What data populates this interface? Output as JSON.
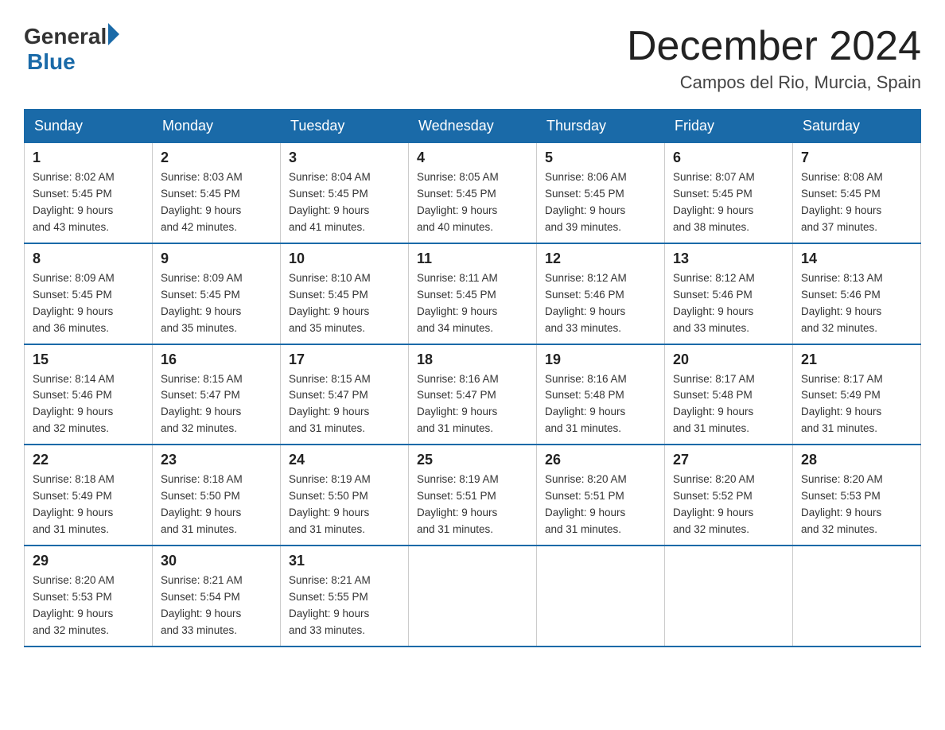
{
  "logo": {
    "text_general": "General",
    "text_blue": "Blue"
  },
  "header": {
    "month_year": "December 2024",
    "location": "Campos del Rio, Murcia, Spain"
  },
  "weekdays": [
    "Sunday",
    "Monday",
    "Tuesday",
    "Wednesday",
    "Thursday",
    "Friday",
    "Saturday"
  ],
  "weeks": [
    [
      {
        "day": "1",
        "sunrise": "8:02 AM",
        "sunset": "5:45 PM",
        "daylight": "9 hours and 43 minutes."
      },
      {
        "day": "2",
        "sunrise": "8:03 AM",
        "sunset": "5:45 PM",
        "daylight": "9 hours and 42 minutes."
      },
      {
        "day": "3",
        "sunrise": "8:04 AM",
        "sunset": "5:45 PM",
        "daylight": "9 hours and 41 minutes."
      },
      {
        "day": "4",
        "sunrise": "8:05 AM",
        "sunset": "5:45 PM",
        "daylight": "9 hours and 40 minutes."
      },
      {
        "day": "5",
        "sunrise": "8:06 AM",
        "sunset": "5:45 PM",
        "daylight": "9 hours and 39 minutes."
      },
      {
        "day": "6",
        "sunrise": "8:07 AM",
        "sunset": "5:45 PM",
        "daylight": "9 hours and 38 minutes."
      },
      {
        "day": "7",
        "sunrise": "8:08 AM",
        "sunset": "5:45 PM",
        "daylight": "9 hours and 37 minutes."
      }
    ],
    [
      {
        "day": "8",
        "sunrise": "8:09 AM",
        "sunset": "5:45 PM",
        "daylight": "9 hours and 36 minutes."
      },
      {
        "day": "9",
        "sunrise": "8:09 AM",
        "sunset": "5:45 PM",
        "daylight": "9 hours and 35 minutes."
      },
      {
        "day": "10",
        "sunrise": "8:10 AM",
        "sunset": "5:45 PM",
        "daylight": "9 hours and 35 minutes."
      },
      {
        "day": "11",
        "sunrise": "8:11 AM",
        "sunset": "5:45 PM",
        "daylight": "9 hours and 34 minutes."
      },
      {
        "day": "12",
        "sunrise": "8:12 AM",
        "sunset": "5:46 PM",
        "daylight": "9 hours and 33 minutes."
      },
      {
        "day": "13",
        "sunrise": "8:12 AM",
        "sunset": "5:46 PM",
        "daylight": "9 hours and 33 minutes."
      },
      {
        "day": "14",
        "sunrise": "8:13 AM",
        "sunset": "5:46 PM",
        "daylight": "9 hours and 32 minutes."
      }
    ],
    [
      {
        "day": "15",
        "sunrise": "8:14 AM",
        "sunset": "5:46 PM",
        "daylight": "9 hours and 32 minutes."
      },
      {
        "day": "16",
        "sunrise": "8:15 AM",
        "sunset": "5:47 PM",
        "daylight": "9 hours and 32 minutes."
      },
      {
        "day": "17",
        "sunrise": "8:15 AM",
        "sunset": "5:47 PM",
        "daylight": "9 hours and 31 minutes."
      },
      {
        "day": "18",
        "sunrise": "8:16 AM",
        "sunset": "5:47 PM",
        "daylight": "9 hours and 31 minutes."
      },
      {
        "day": "19",
        "sunrise": "8:16 AM",
        "sunset": "5:48 PM",
        "daylight": "9 hours and 31 minutes."
      },
      {
        "day": "20",
        "sunrise": "8:17 AM",
        "sunset": "5:48 PM",
        "daylight": "9 hours and 31 minutes."
      },
      {
        "day": "21",
        "sunrise": "8:17 AM",
        "sunset": "5:49 PM",
        "daylight": "9 hours and 31 minutes."
      }
    ],
    [
      {
        "day": "22",
        "sunrise": "8:18 AM",
        "sunset": "5:49 PM",
        "daylight": "9 hours and 31 minutes."
      },
      {
        "day": "23",
        "sunrise": "8:18 AM",
        "sunset": "5:50 PM",
        "daylight": "9 hours and 31 minutes."
      },
      {
        "day": "24",
        "sunrise": "8:19 AM",
        "sunset": "5:50 PM",
        "daylight": "9 hours and 31 minutes."
      },
      {
        "day": "25",
        "sunrise": "8:19 AM",
        "sunset": "5:51 PM",
        "daylight": "9 hours and 31 minutes."
      },
      {
        "day": "26",
        "sunrise": "8:20 AM",
        "sunset": "5:51 PM",
        "daylight": "9 hours and 31 minutes."
      },
      {
        "day": "27",
        "sunrise": "8:20 AM",
        "sunset": "5:52 PM",
        "daylight": "9 hours and 32 minutes."
      },
      {
        "day": "28",
        "sunrise": "8:20 AM",
        "sunset": "5:53 PM",
        "daylight": "9 hours and 32 minutes."
      }
    ],
    [
      {
        "day": "29",
        "sunrise": "8:20 AM",
        "sunset": "5:53 PM",
        "daylight": "9 hours and 32 minutes."
      },
      {
        "day": "30",
        "sunrise": "8:21 AM",
        "sunset": "5:54 PM",
        "daylight": "9 hours and 33 minutes."
      },
      {
        "day": "31",
        "sunrise": "8:21 AM",
        "sunset": "5:55 PM",
        "daylight": "9 hours and 33 minutes."
      },
      null,
      null,
      null,
      null
    ]
  ],
  "labels": {
    "sunrise": "Sunrise:",
    "sunset": "Sunset:",
    "daylight": "Daylight:"
  }
}
